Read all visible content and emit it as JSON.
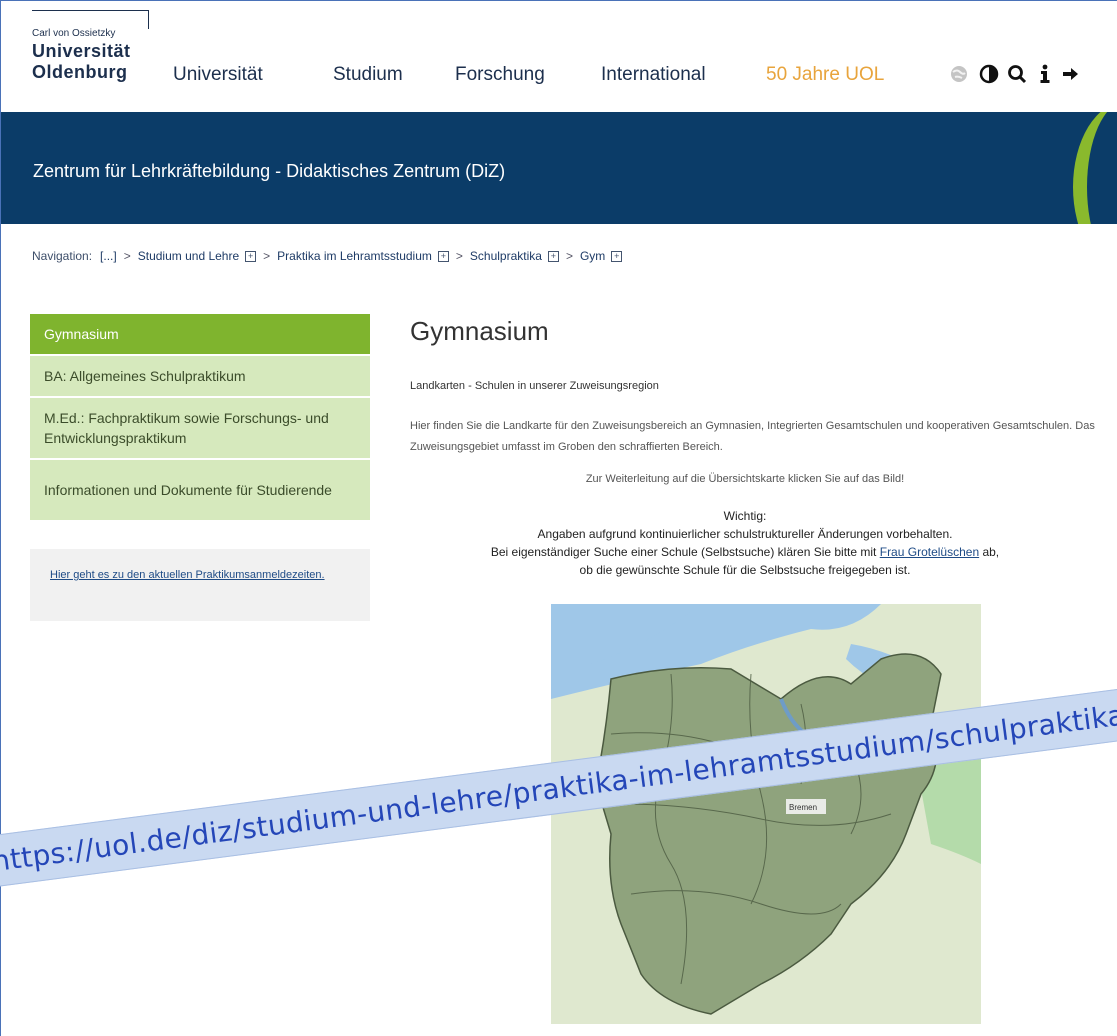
{
  "logo": {
    "line1": "Carl von Ossietzky",
    "line2": "Universität",
    "line3": "Oldenburg",
    "color": "#1c2f4d"
  },
  "nav": {
    "items": [
      "Universität",
      "Studium",
      "Forschung",
      "International",
      "50 Jahre UOL"
    ],
    "accent_color": "#e8a43c"
  },
  "tools": {
    "icons": [
      "globe-icon",
      "contrast-icon",
      "search-icon",
      "info-icon",
      "login-icon"
    ],
    "glyphs": [
      "",
      "◐",
      "Q",
      "i",
      "➔"
    ]
  },
  "banner": {
    "title": "Zentrum für Lehrkräftebildung - Didaktisches Zentrum (DiZ)",
    "bg_color": "#0b3c68"
  },
  "breadcrumb": {
    "label": "Navigation:",
    "items": [
      "[...]",
      "Studium und Lehre",
      "Praktika im Lehramtsstudium",
      "Schulpraktika",
      "Gym"
    ],
    "separator": ">",
    "expand_glyph": "+"
  },
  "sidebar": {
    "items": [
      {
        "label": "Gymnasium",
        "active": true
      },
      {
        "label": "BA: Allgemeines Schulpraktikum",
        "active": false
      },
      {
        "label": "M.Ed.: Fachpraktikum sowie Forschungs- und Entwicklungspraktikum",
        "active": false
      },
      {
        "label": "Informationen und Dokumente für Studierende",
        "active": false
      }
    ],
    "info_link": "Hier geht es zu den aktuellen Praktikumsanmeldezeiten.",
    "active_color": "#7fb42e",
    "item_color": "#d6e9bd"
  },
  "main": {
    "title": "Gymnasium",
    "subtitle": "Landkarten - Schulen in unserer Zuweisungsregion",
    "paragraph": "Hier finden Sie die Landkarte für den Zuweisungsbereich an Gymnasien, Integrierten Gesamtschulen und kooperativen Gesamtschulen. Das Zuweisungsgebiet umfasst im Groben den schraffierten Bereich.",
    "click_hint": "Zur Weiterleitung auf die Übersichtskarte klicken Sie auf das Bild!",
    "important_heading": "Wichtig:",
    "important_line1": "Angaben aufgrund kontinuierlicher schulstruktureller Änderungen vorbehalten.",
    "important_line2_pre": "Bei eigenständiger Suche einer Schule (Selbstsuche) klären Sie bitte mit ",
    "important_link": "Frau Grotelüschen",
    "important_line2_post": " ab,",
    "important_line3": "ob die gewünschte Schule für die Selbstsuche freigegeben ist."
  },
  "map": {
    "label": "Bremen"
  },
  "overlay": {
    "url": "https://uol.de/diz/studium-und-lehre/praktika-im-lehramtsstudium/schulpraktika"
  }
}
